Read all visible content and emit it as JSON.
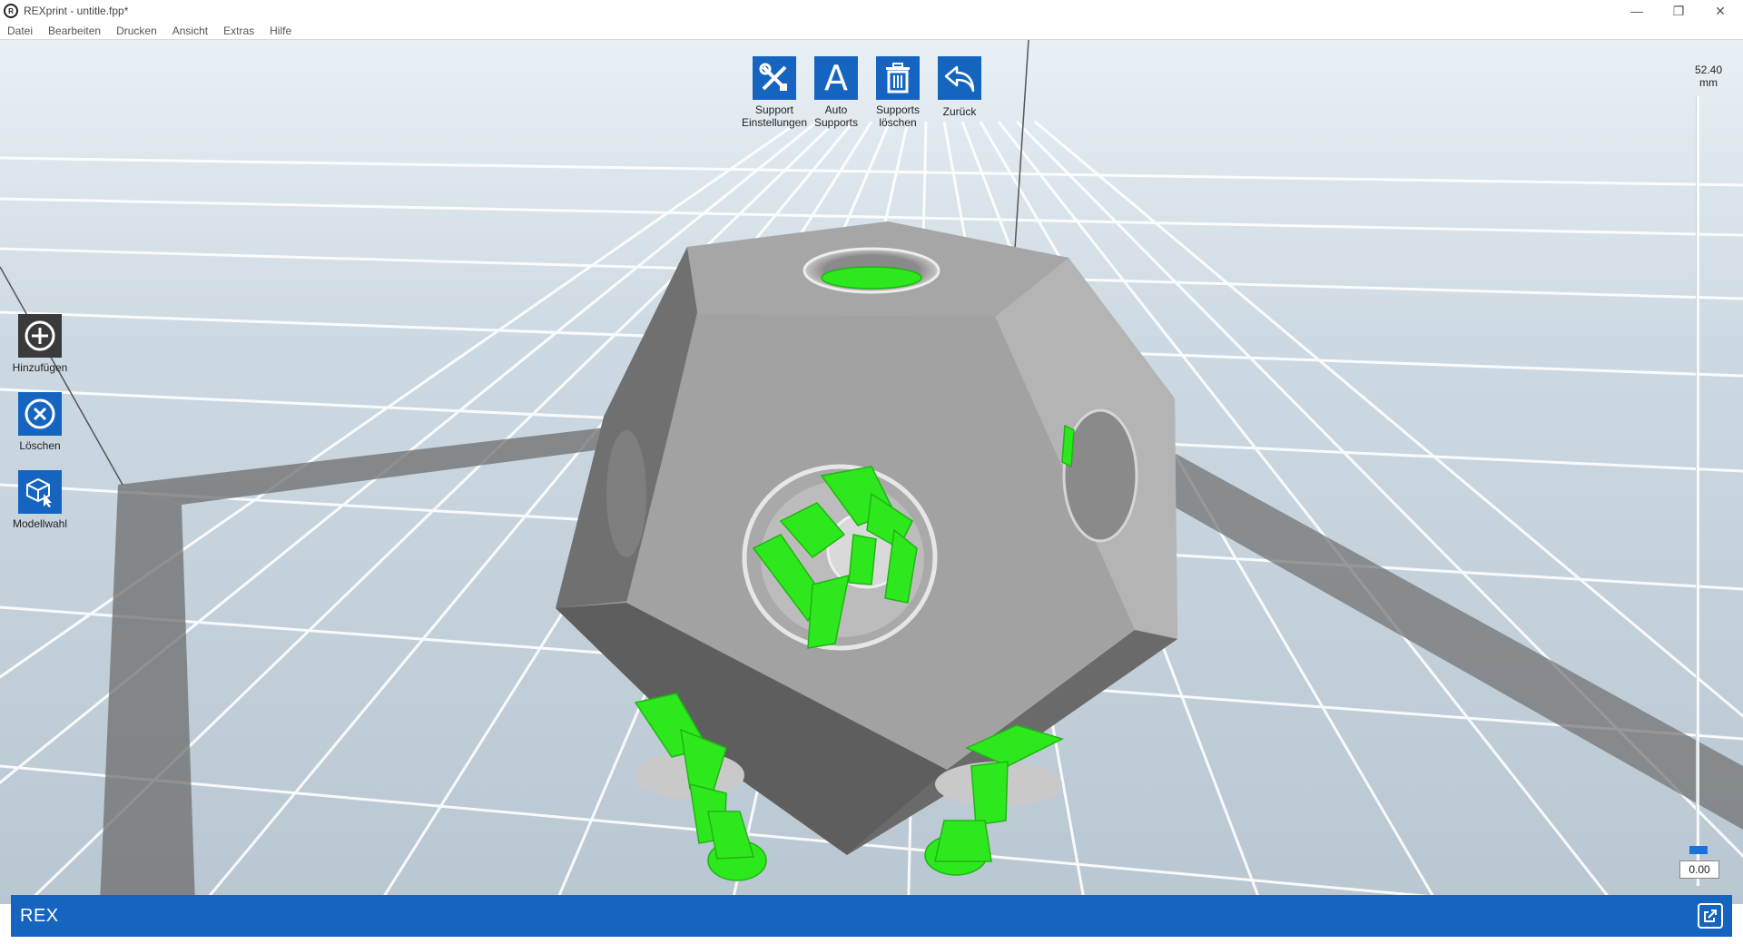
{
  "window": {
    "title": "REXprint - untitle.fpp*",
    "app_icon": "rex-logo-icon",
    "controls": [
      "minimize-icon",
      "restore-icon",
      "close-icon"
    ]
  },
  "menu": [
    "Datei",
    "Bearbeiten",
    "Drucken",
    "Ansicht",
    "Extras",
    "Hilfe"
  ],
  "toolbar": {
    "support_settings": {
      "label": "Support\nEinstellungen",
      "icon": "tools-icon"
    },
    "auto_supports": {
      "label": "Auto\nSupports",
      "icon": "letter-a-icon"
    },
    "delete_supports": {
      "label": "Supports\nlöschen",
      "icon": "trash-icon"
    },
    "back": {
      "label": "Zurück",
      "icon": "undo-icon"
    }
  },
  "left_tools": {
    "add": {
      "label": "Hinzufügen",
      "icon": "plus-circle-icon"
    },
    "delete": {
      "label": "Löschen",
      "icon": "x-circle-icon"
    },
    "model_select": {
      "label": "Modellwahl",
      "icon": "cube-cursor-icon"
    }
  },
  "height_slider": {
    "max_value": "52.40",
    "unit": "mm",
    "min_value": "0.00",
    "level": 0
  },
  "statusbar": {
    "brand": "REX",
    "icon": "external-link-icon"
  },
  "colors": {
    "accent": "#1565c0",
    "support": "#2ee81e",
    "model": "#9a9a9a",
    "grid": "#ffffff",
    "plate_border": "#6e6e6e"
  }
}
